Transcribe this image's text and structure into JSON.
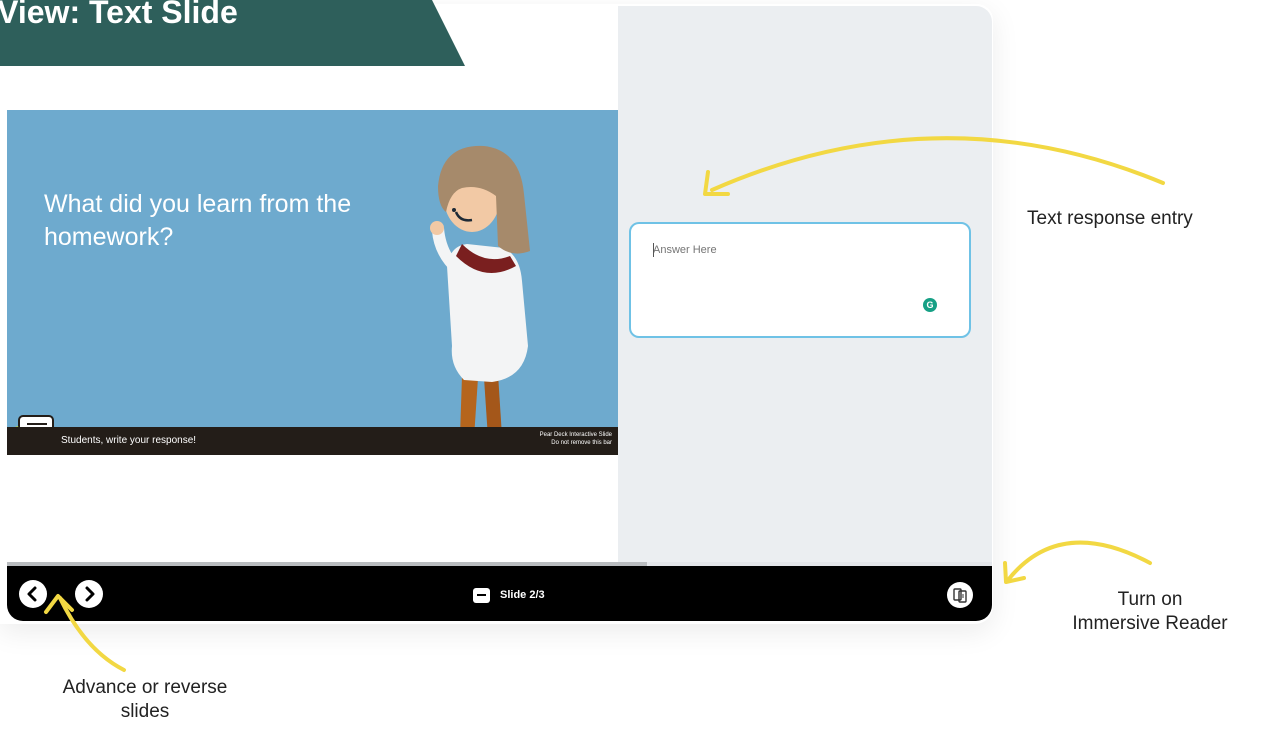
{
  "banner": {
    "title": "nt View: Text Slide"
  },
  "slide": {
    "prompt": "What did you learn from the homework?",
    "footer_left": "Students, write your response!",
    "footer_right_line1": "Pear Deck Interactive Slide",
    "footer_right_line2": "Do not remove this bar"
  },
  "answer": {
    "placeholder": "Answer Here",
    "value": ""
  },
  "navigation": {
    "prev_icon": "chevron-left-icon",
    "next_icon": "chevron-right-icon",
    "slide_label": "Slide 2/3",
    "progress": 0.667
  },
  "annotations": {
    "text_response": "Text response entry",
    "immersive_reader": [
      "Turn on",
      "Immersive Reader"
    ],
    "advance": [
      "Advance or reverse",
      "slides"
    ]
  },
  "colors": {
    "banner": "#2e5f5b",
    "slide_bg": "#6eaace",
    "answer_border": "#6fc2e6",
    "arrow": "#f2d843"
  }
}
